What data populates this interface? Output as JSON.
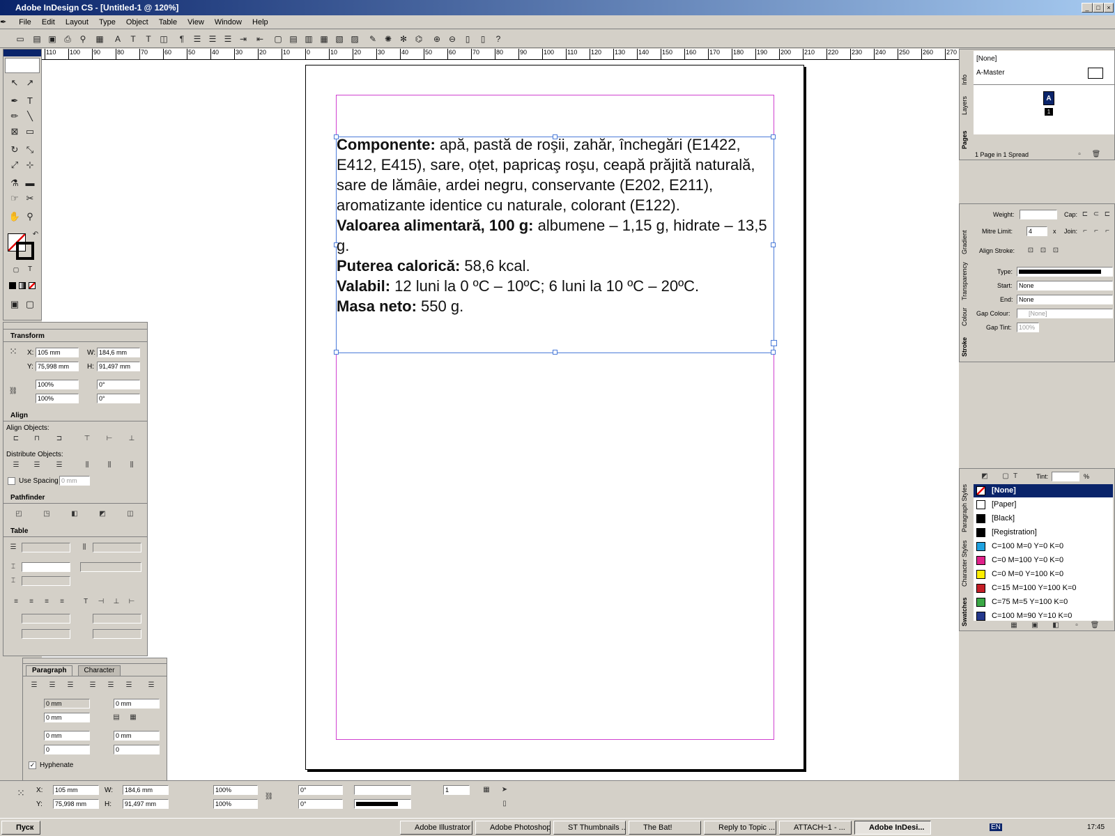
{
  "window": {
    "title": "Adobe InDesign CS - [Untitled-1 @ 120%]"
  },
  "menu": [
    "File",
    "Edit",
    "Layout",
    "Type",
    "Object",
    "Table",
    "View",
    "Window",
    "Help"
  ],
  "ruler_ticks": [
    "110",
    "100",
    "90",
    "80",
    "70",
    "60",
    "50",
    "40",
    "30",
    "20",
    "10",
    "0",
    "10",
    "20",
    "30",
    "40",
    "50",
    "60",
    "70",
    "80",
    "90",
    "100",
    "110",
    "120",
    "130",
    "140",
    "150",
    "160",
    "170",
    "180",
    "190",
    "200",
    "210",
    "220",
    "230",
    "240",
    "250",
    "260",
    "270"
  ],
  "document": {
    "paragraphs": [
      {
        "bold": "Componente:",
        "rest": " apă, pastă de roşii, zahăr, închegări (E1422, E412, E415), sare, oțet, papricaş roşu, ceapă prăjită naturală, sare de lămâie, ardei negru, conservante (E202, E211), aromatizante identice cu naturale, colorant (E122)."
      },
      {
        "bold": "Valoarea alimentară, 100 g:",
        "rest": " albumene – 1,15 g, hidrate – 13,5 g."
      },
      {
        "bold": "Puterea calorică:",
        "rest": " 58,6 kcal."
      },
      {
        "bold": "Valabil:",
        "rest": " 12 luni la 0 ºC – 10ºC; 6 luni la 10 ºC – 20ºC."
      },
      {
        "bold": "Masa neto:",
        "rest": " 550 g."
      }
    ]
  },
  "transform": {
    "title": "Transform",
    "x_label": "X:",
    "x": "105 mm",
    "y_label": "Y:",
    "y": "75,998 mm",
    "w_label": "W:",
    "w": "184,6 mm",
    "h_label": "H:",
    "h": "91,497 mm",
    "scale_x": "100%",
    "scale_y": "100%",
    "rotate": "0°",
    "shear": "0°"
  },
  "align": {
    "title": "Align",
    "align_objects": "Align Objects:",
    "distribute_objects": "Distribute Objects:",
    "use_spacing": "Use Spacing",
    "spacing": "0 mm"
  },
  "pathfinder": {
    "title": "Pathfinder"
  },
  "table": {
    "title": "Table"
  },
  "paragraph": {
    "tab1": "Paragraph",
    "tab2": "Character",
    "left_indent": "0 mm",
    "right_indent": "0 mm",
    "first_indent": "0 mm",
    "space_before": "0 mm",
    "space_after": "0 mm",
    "drop_lines": "0",
    "drop_chars": "0",
    "hyphenate": "Hyphenate"
  },
  "pages": {
    "none": "[None]",
    "master": "A-Master",
    "page_a": "A",
    "page_num": "1",
    "footer": "1 Page in 1 Spread",
    "tabs": [
      "Pages",
      "Layers",
      "Info"
    ]
  },
  "stroke": {
    "weight": "Weight:",
    "cap": "Cap:",
    "mitre": "Mitre Limit:",
    "mitre_val": "4",
    "x": "x",
    "join": "Join:",
    "align_stroke": "Align Stroke:",
    "type": "Type:",
    "start": "Start:",
    "start_val": "None",
    "end": "End:",
    "end_val": "None",
    "gap_colour": "Gap Colour:",
    "gap_colour_val": "[None]",
    "gap_tint": "Gap Tint:",
    "gap_tint_val": "100%",
    "tabs": [
      "Stroke",
      "Colour",
      "Transparency",
      "Gradient"
    ]
  },
  "swatches": {
    "tint": "Tint:",
    "pct": "%",
    "tabs": [
      "Swatches",
      "Character Styles",
      "Paragraph Styles"
    ],
    "items": [
      {
        "name": "[None]",
        "color": "#ffffff"
      },
      {
        "name": "[Paper]",
        "color": "#ffffff"
      },
      {
        "name": "[Black]",
        "color": "#000000"
      },
      {
        "name": "[Registration]",
        "color": "#000000"
      },
      {
        "name": "C=100 M=0 Y=0 K=0",
        "color": "#1fa2e0"
      },
      {
        "name": "C=0 M=100 Y=0 K=0",
        "color": "#e0218a"
      },
      {
        "name": "C=0 M=0 Y=100 K=0",
        "color": "#ffee00"
      },
      {
        "name": "C=15 M=100 Y=100 K=0",
        "color": "#c41e26"
      },
      {
        "name": "C=75 M=5 Y=100 K=0",
        "color": "#3aa845"
      },
      {
        "name": "C=100 M=90 Y=10 K=0",
        "color": "#24388c"
      }
    ]
  },
  "statusbar": {
    "x": "105 mm",
    "y": "75,998 mm",
    "w": "184,6 mm",
    "h": "91,497 mm",
    "sx": "100%",
    "sy": "100%",
    "rot": "0°",
    "shear": "0°",
    "cols": "1"
  },
  "taskbar": {
    "start": "Пуск",
    "tasks": [
      "Adobe Illustrator",
      "Adobe Photoshop",
      "ST Thumbnails ...",
      "The Bat!",
      "Reply to Topic ...",
      "ATTACH~1 - ...",
      "Adobe InDesi..."
    ],
    "clock": "17:45",
    "lang": "EN"
  }
}
